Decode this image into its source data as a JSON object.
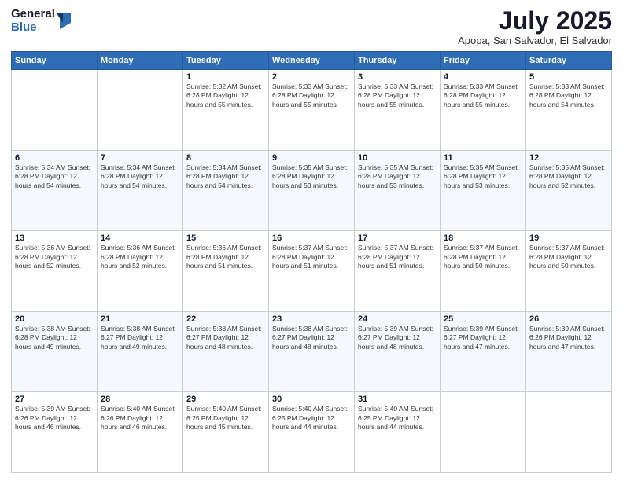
{
  "header": {
    "logo_general": "General",
    "logo_blue": "Blue",
    "month_title": "July 2025",
    "location": "Apopa, San Salvador, El Salvador"
  },
  "days_of_week": [
    "Sunday",
    "Monday",
    "Tuesday",
    "Wednesday",
    "Thursday",
    "Friday",
    "Saturday"
  ],
  "weeks": [
    [
      {
        "day": "",
        "info": ""
      },
      {
        "day": "",
        "info": ""
      },
      {
        "day": "1",
        "info": "Sunrise: 5:32 AM\nSunset: 6:28 PM\nDaylight: 12 hours and 55 minutes."
      },
      {
        "day": "2",
        "info": "Sunrise: 5:33 AM\nSunset: 6:28 PM\nDaylight: 12 hours and 55 minutes."
      },
      {
        "day": "3",
        "info": "Sunrise: 5:33 AM\nSunset: 6:28 PM\nDaylight: 12 hours and 55 minutes."
      },
      {
        "day": "4",
        "info": "Sunrise: 5:33 AM\nSunset: 6:28 PM\nDaylight: 12 hours and 55 minutes."
      },
      {
        "day": "5",
        "info": "Sunrise: 5:33 AM\nSunset: 6:28 PM\nDaylight: 12 hours and 54 minutes."
      }
    ],
    [
      {
        "day": "6",
        "info": "Sunrise: 5:34 AM\nSunset: 6:28 PM\nDaylight: 12 hours and 54 minutes."
      },
      {
        "day": "7",
        "info": "Sunrise: 5:34 AM\nSunset: 6:28 PM\nDaylight: 12 hours and 54 minutes."
      },
      {
        "day": "8",
        "info": "Sunrise: 5:34 AM\nSunset: 6:28 PM\nDaylight: 12 hours and 54 minutes."
      },
      {
        "day": "9",
        "info": "Sunrise: 5:35 AM\nSunset: 6:28 PM\nDaylight: 12 hours and 53 minutes."
      },
      {
        "day": "10",
        "info": "Sunrise: 5:35 AM\nSunset: 6:28 PM\nDaylight: 12 hours and 53 minutes."
      },
      {
        "day": "11",
        "info": "Sunrise: 5:35 AM\nSunset: 6:28 PM\nDaylight: 12 hours and 53 minutes."
      },
      {
        "day": "12",
        "info": "Sunrise: 5:35 AM\nSunset: 6:28 PM\nDaylight: 12 hours and 52 minutes."
      }
    ],
    [
      {
        "day": "13",
        "info": "Sunrise: 5:36 AM\nSunset: 6:28 PM\nDaylight: 12 hours and 52 minutes."
      },
      {
        "day": "14",
        "info": "Sunrise: 5:36 AM\nSunset: 6:28 PM\nDaylight: 12 hours and 52 minutes."
      },
      {
        "day": "15",
        "info": "Sunrise: 5:36 AM\nSunset: 6:28 PM\nDaylight: 12 hours and 51 minutes."
      },
      {
        "day": "16",
        "info": "Sunrise: 5:37 AM\nSunset: 6:28 PM\nDaylight: 12 hours and 51 minutes."
      },
      {
        "day": "17",
        "info": "Sunrise: 5:37 AM\nSunset: 6:28 PM\nDaylight: 12 hours and 51 minutes."
      },
      {
        "day": "18",
        "info": "Sunrise: 5:37 AM\nSunset: 6:28 PM\nDaylight: 12 hours and 50 minutes."
      },
      {
        "day": "19",
        "info": "Sunrise: 5:37 AM\nSunset: 6:28 PM\nDaylight: 12 hours and 50 minutes."
      }
    ],
    [
      {
        "day": "20",
        "info": "Sunrise: 5:38 AM\nSunset: 6:28 PM\nDaylight: 12 hours and 49 minutes."
      },
      {
        "day": "21",
        "info": "Sunrise: 5:38 AM\nSunset: 6:27 PM\nDaylight: 12 hours and 49 minutes."
      },
      {
        "day": "22",
        "info": "Sunrise: 5:38 AM\nSunset: 6:27 PM\nDaylight: 12 hours and 48 minutes."
      },
      {
        "day": "23",
        "info": "Sunrise: 5:38 AM\nSunset: 6:27 PM\nDaylight: 12 hours and 48 minutes."
      },
      {
        "day": "24",
        "info": "Sunrise: 5:39 AM\nSunset: 6:27 PM\nDaylight: 12 hours and 48 minutes."
      },
      {
        "day": "25",
        "info": "Sunrise: 5:39 AM\nSunset: 6:27 PM\nDaylight: 12 hours and 47 minutes."
      },
      {
        "day": "26",
        "info": "Sunrise: 5:39 AM\nSunset: 6:26 PM\nDaylight: 12 hours and 47 minutes."
      }
    ],
    [
      {
        "day": "27",
        "info": "Sunrise: 5:39 AM\nSunset: 6:26 PM\nDaylight: 12 hours and 46 minutes."
      },
      {
        "day": "28",
        "info": "Sunrise: 5:40 AM\nSunset: 6:26 PM\nDaylight: 12 hours and 46 minutes."
      },
      {
        "day": "29",
        "info": "Sunrise: 5:40 AM\nSunset: 6:25 PM\nDaylight: 12 hours and 45 minutes."
      },
      {
        "day": "30",
        "info": "Sunrise: 5:40 AM\nSunset: 6:25 PM\nDaylight: 12 hours and 44 minutes."
      },
      {
        "day": "31",
        "info": "Sunrise: 5:40 AM\nSunset: 6:25 PM\nDaylight: 12 hours and 44 minutes."
      },
      {
        "day": "",
        "info": ""
      },
      {
        "day": "",
        "info": ""
      }
    ]
  ]
}
